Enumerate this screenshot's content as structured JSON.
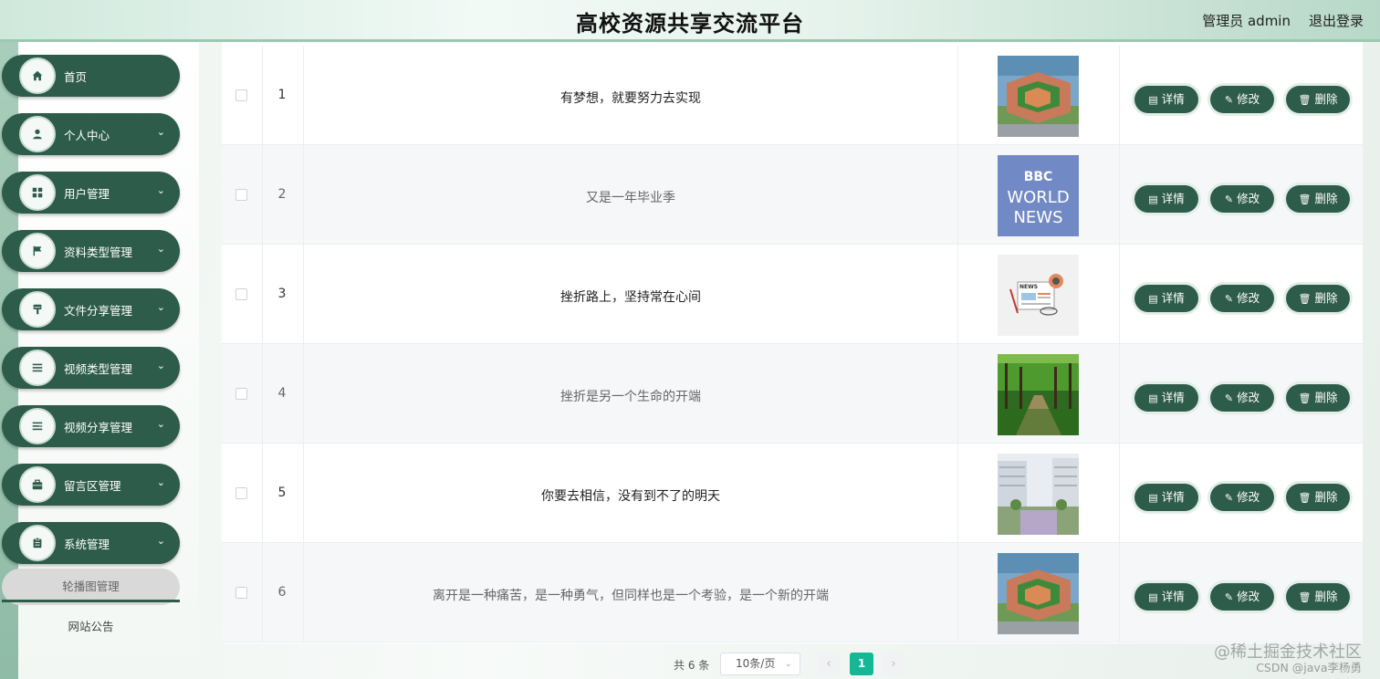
{
  "header": {
    "title": "高校资源共享交流平台",
    "user": "管理员 admin",
    "logout": "退出登录"
  },
  "sidebar": {
    "items": [
      {
        "label": "首页",
        "icon": "home-icon",
        "expandable": false
      },
      {
        "label": "个人中心",
        "icon": "user-icon",
        "expandable": true
      },
      {
        "label": "用户管理",
        "icon": "grid-icon",
        "expandable": true
      },
      {
        "label": "资料类型管理",
        "icon": "flag-icon",
        "expandable": true
      },
      {
        "label": "文件分享管理",
        "icon": "brush-icon",
        "expandable": true
      },
      {
        "label": "视频类型管理",
        "icon": "list-icon",
        "expandable": true
      },
      {
        "label": "视频分享管理",
        "icon": "sort-icon",
        "expandable": true
      },
      {
        "label": "留言区管理",
        "icon": "briefcase-icon",
        "expandable": true
      },
      {
        "label": "系统管理",
        "icon": "clipboard-icon",
        "expandable": true
      }
    ],
    "sub_items": [
      {
        "label": "轮播图管理",
        "active": true
      },
      {
        "label": "网站公告",
        "active": false
      }
    ]
  },
  "table": {
    "rows": [
      {
        "index": "1",
        "text": "有梦想，就要努力去实现",
        "image": "campus-aerial-image"
      },
      {
        "index": "2",
        "text": "又是一年毕业季",
        "image": "bbc-world-news-image"
      },
      {
        "index": "3",
        "text": "挫折路上，坚持常在心间",
        "image": "news-illustration-image"
      },
      {
        "index": "4",
        "text": "挫折是另一个生命的开端",
        "image": "tree-path-image"
      },
      {
        "index": "5",
        "text": "你要去相信，没有到不了的明天",
        "image": "modern-campus-image"
      },
      {
        "index": "6",
        "text": "离开是一种痛苦，是一种勇气，但同样也是一个考验，是一个新的开端",
        "image": "campus-aerial-image"
      }
    ],
    "actions": {
      "detail": "详情",
      "edit": "修改",
      "delete": "删除"
    },
    "bbc_text": {
      "top": "BBC",
      "mid": "WORLD",
      "bottom": "NEWS"
    },
    "news_text": "NEWS"
  },
  "pagination": {
    "total": "共 6 条",
    "page_size": "10条/页",
    "current_page": "1",
    "prev": "‹",
    "next": "›"
  },
  "watermark": {
    "line1": "@稀土掘金技术社区",
    "line2": "CSDN @java李杨勇"
  },
  "colors": {
    "primary": "#2e5c4a",
    "accent": "#14b894"
  }
}
